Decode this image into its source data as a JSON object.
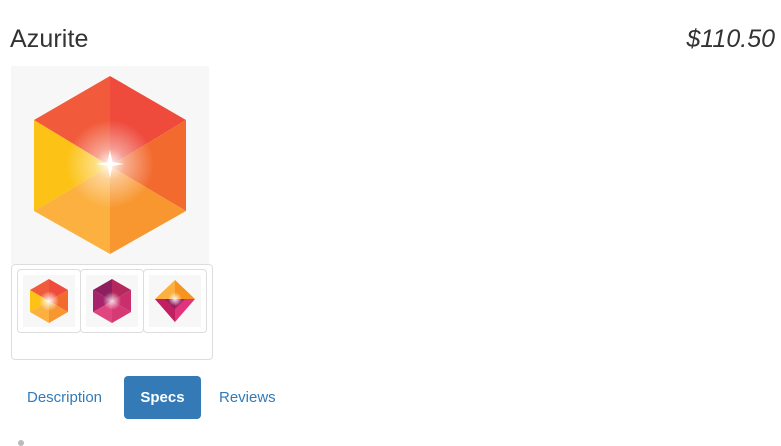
{
  "product": {
    "name": "Azurite",
    "price": "$110.50"
  },
  "main_image": {
    "icon": "orange-hexagon-gem-icon"
  },
  "thumbnails": [
    {
      "icon": "orange-hexagon-gem-thumbnail",
      "selected": true
    },
    {
      "icon": "magenta-hexagon-gem-thumbnail",
      "selected": false
    },
    {
      "icon": "diamond-gem-thumbnail",
      "selected": false
    }
  ],
  "tabs": [
    {
      "label": "Description",
      "active": false
    },
    {
      "label": "Specs",
      "active": true
    },
    {
      "label": "Reviews",
      "active": false
    }
  ],
  "colors": {
    "accent": "#337ab7",
    "text": "#333333",
    "border": "#dddddd",
    "image_background": "#f7f7f7"
  }
}
